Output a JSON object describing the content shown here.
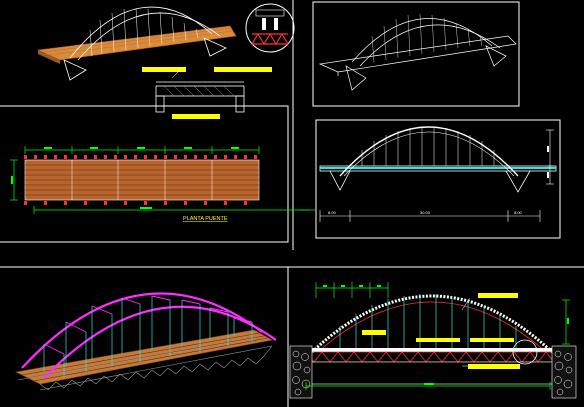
{
  "drawing": {
    "plan_title": "PLANTA PUENTE",
    "dims": {
      "elev_left": "8.00",
      "elev_center": "30.00",
      "elev_right": "8.00"
    }
  },
  "colors": {
    "background": "#000000",
    "frame": "#ffffff",
    "deck_wood": "#d98a3a",
    "arch_white": "#ffffff",
    "arch_magenta": "#ff2dff",
    "hanger_cyan": "#38e0e0",
    "annotation_yellow": "#ffff00",
    "dimension_green": "#00ff00",
    "truss_red": "#ff3030",
    "deck_blue": "#4aa8ff"
  }
}
